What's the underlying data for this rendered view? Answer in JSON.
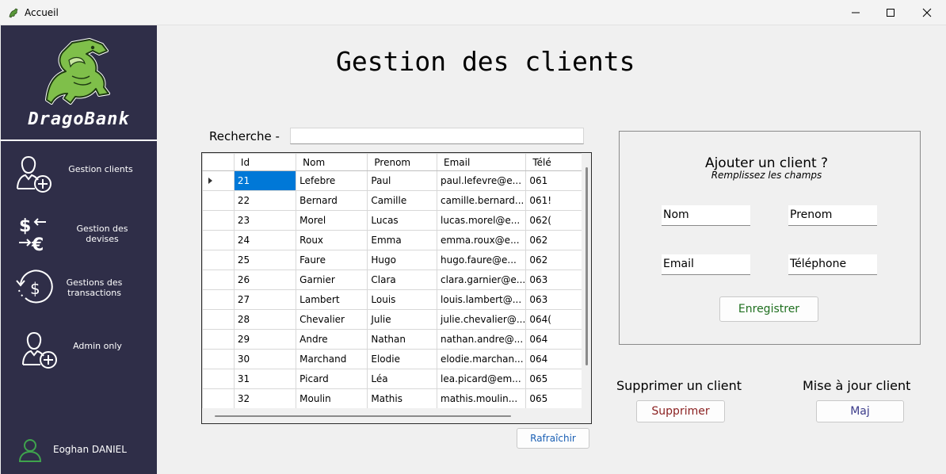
{
  "window": {
    "title": "Accueil"
  },
  "sidebar": {
    "brand": "DragoBank",
    "items": [
      {
        "label": "Gestion clients",
        "icon": "user-add-icon"
      },
      {
        "label": "Gestion des devises",
        "icon": "currency-exchange-icon"
      },
      {
        "label": "Gestions des transactions",
        "icon": "transaction-history-icon"
      },
      {
        "label": "Admin only",
        "icon": "user-add-icon"
      }
    ],
    "user": {
      "name": "Eoghan DANIEL"
    }
  },
  "main": {
    "title": "Gestion des clients",
    "search": {
      "label": "Recherche  -",
      "value": ""
    },
    "table": {
      "columns": [
        "Id",
        "Nom",
        "Prenom",
        "Email",
        "Télé"
      ],
      "rows": [
        [
          "21",
          "Lefebre",
          "Paul",
          "paul.lefevre@e...",
          "061"
        ],
        [
          "22",
          "Bernard",
          "Camille",
          "camille.bernard...",
          "061!"
        ],
        [
          "23",
          "Morel",
          "Lucas",
          "lucas.morel@e...",
          "062("
        ],
        [
          "24",
          "Roux",
          "Emma",
          "emma.roux@e...",
          "062"
        ],
        [
          "25",
          "Faure",
          "Hugo",
          "hugo.faure@e...",
          "062"
        ],
        [
          "26",
          "Garnier",
          "Clara",
          "clara.garnier@e...",
          "063"
        ],
        [
          "27",
          "Lambert",
          "Louis",
          "louis.lambert@...",
          "063"
        ],
        [
          "28",
          "Chevalier",
          "Julie",
          "julie.chevalier@...",
          "064("
        ],
        [
          "29",
          "Andre",
          "Nathan",
          "nathan.andre@...",
          "064"
        ],
        [
          "30",
          "Marchand",
          "Elodie",
          "elodie.marchan...",
          "064"
        ],
        [
          "31",
          "Picard",
          "Léa",
          "lea.picard@em...",
          "065"
        ],
        [
          "32",
          "Moulin",
          "Mathis",
          "mathis.moulin...",
          "065"
        ]
      ],
      "selected_row": 0
    },
    "refresh_label": "Rafraîchir",
    "form": {
      "title": "Ajouter un client ?",
      "subtitle": "Remplissez les champs",
      "fields": {
        "nom": "Nom",
        "prenom": "Prenom",
        "email": "Email",
        "telephone": "Téléphone"
      },
      "save_label": "Enregistrer"
    },
    "delete": {
      "label": "Supprimer un client",
      "button": "Supprimer"
    },
    "update": {
      "label": "Mise à jour client",
      "button": "Maj"
    }
  },
  "colors": {
    "sidebar_bg": "#2f2e48",
    "selection": "#0078d7",
    "save_text": "#1f6f1f",
    "delete_text": "#8a1f1f",
    "update_text": "#3b3b8a",
    "refresh_text": "#1a5fb4",
    "user_icon": "#3fa34d"
  }
}
